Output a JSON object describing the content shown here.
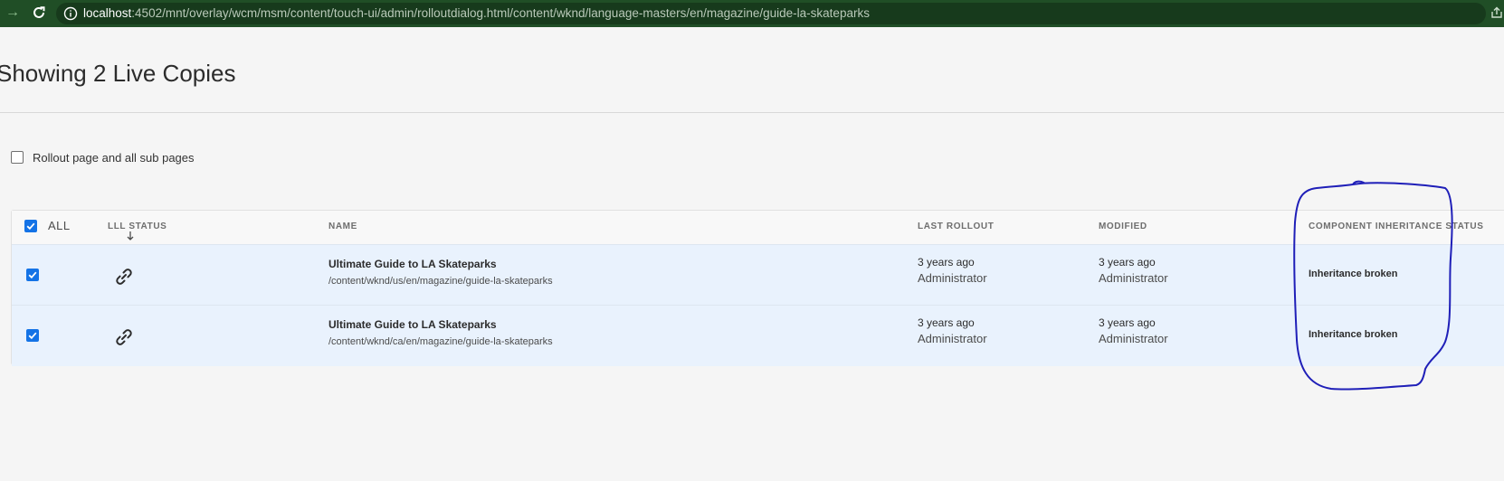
{
  "browser": {
    "url_host": "localhost",
    "url_rest": ":4502/mnt/overlay/wcm/msm/content/touch-ui/admin/rolloutdialog.html/content/wknd/language-masters/en/magazine/guide-la-skateparks"
  },
  "page": {
    "title": "Showing 2 Live Copies",
    "subpages_label": "Rollout page and all sub pages"
  },
  "table": {
    "all_label": "ALL",
    "columns": {
      "lll_status": "LLL STATUS",
      "name": "NAME",
      "last_rollout": "LAST ROLLOUT",
      "modified": "MODIFIED",
      "component_status": "COMPONENT INHERITANCE STATUS"
    },
    "rows": [
      {
        "title": "Ultimate Guide to LA Skateparks",
        "path": "/content/wknd/us/en/magazine/guide-la-skateparks",
        "last_rollout_time": "3 years ago",
        "last_rollout_user": "Administrator",
        "modified_time": "3 years ago",
        "modified_user": "Administrator",
        "status": "Inheritance broken"
      },
      {
        "title": "Ultimate Guide to LA Skateparks",
        "path": "/content/wknd/ca/en/magazine/guide-la-skateparks",
        "last_rollout_time": "3 years ago",
        "last_rollout_user": "Administrator",
        "modified_time": "3 years ago",
        "modified_user": "Administrator",
        "status": "Inheritance broken"
      }
    ]
  },
  "icons": {
    "back": "arrow-right-icon",
    "reload": "reload-icon",
    "info": "info-icon",
    "share": "share-icon",
    "sort": "sort-down-arrow-icon",
    "link": "link-icon",
    "checkbox": "checkmark-icon"
  },
  "colors": {
    "browser_bar": "#204e26",
    "accent_blue": "#1473e6",
    "selected_row": "#e9f2fd",
    "annotation_ink": "#1f1fb8"
  }
}
